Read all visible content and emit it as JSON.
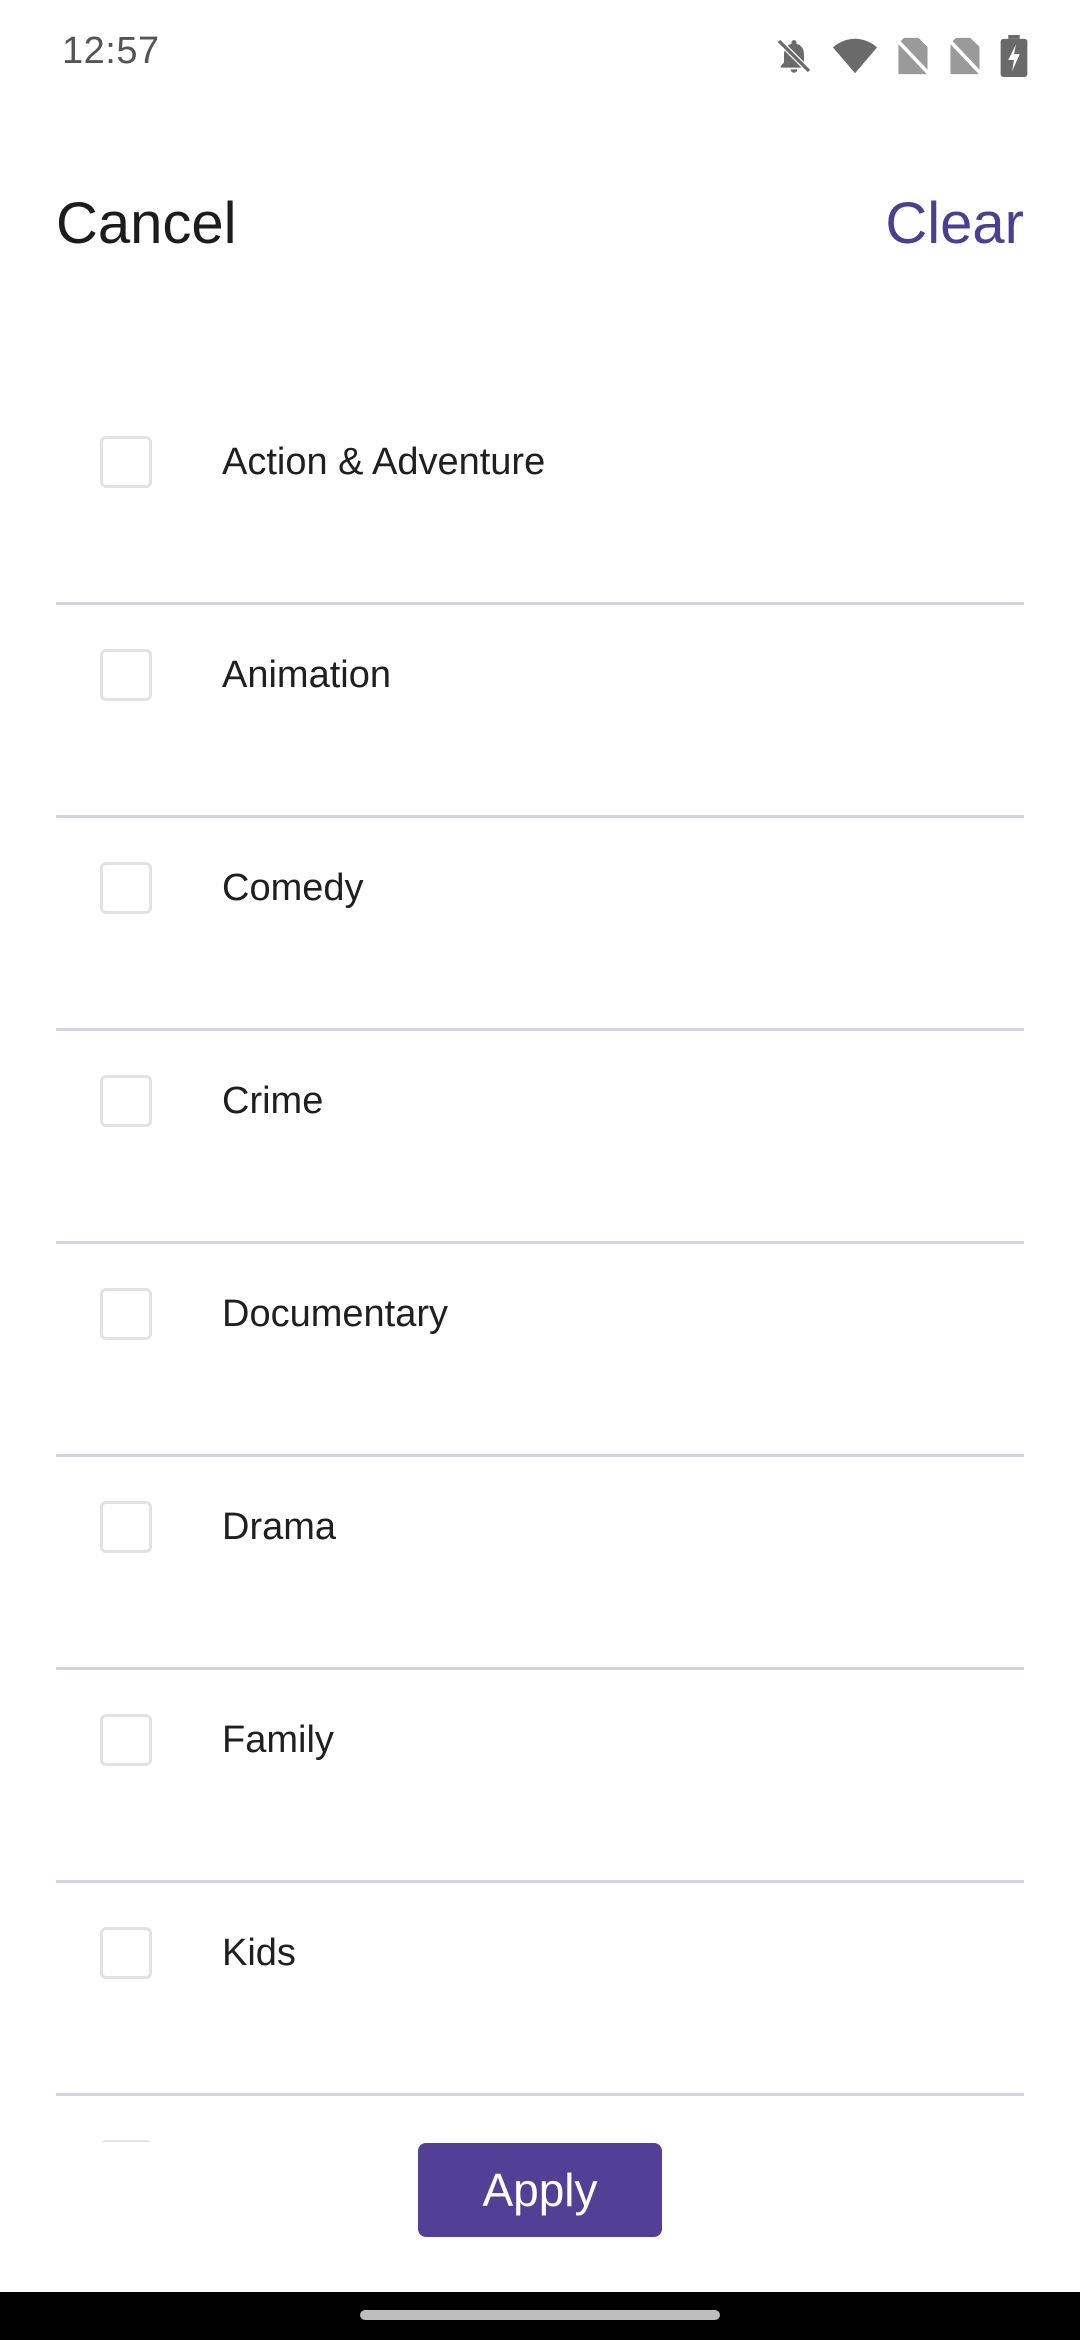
{
  "status_bar": {
    "time": "12:57",
    "icons": [
      "notifications-off-icon",
      "wifi-icon",
      "no-sim-icon",
      "no-sim-icon",
      "battery-charging-icon"
    ]
  },
  "header": {
    "cancel_label": "Cancel",
    "clear_label": "Clear"
  },
  "genres": [
    {
      "label": "Action & Adventure",
      "checked": false
    },
    {
      "label": "Animation",
      "checked": false
    },
    {
      "label": "Comedy",
      "checked": false
    },
    {
      "label": "Crime",
      "checked": false
    },
    {
      "label": "Documentary",
      "checked": false
    },
    {
      "label": "Drama",
      "checked": false
    },
    {
      "label": "Family",
      "checked": false
    },
    {
      "label": "Kids",
      "checked": false
    },
    {
      "label": "",
      "checked": false
    }
  ],
  "footer": {
    "apply_label": "Apply"
  },
  "colors": {
    "accent": "#524096",
    "clear_text": "#4b3f8f",
    "divider": "#d3d3e2",
    "checkbox_border": "#e2e2e2"
  }
}
